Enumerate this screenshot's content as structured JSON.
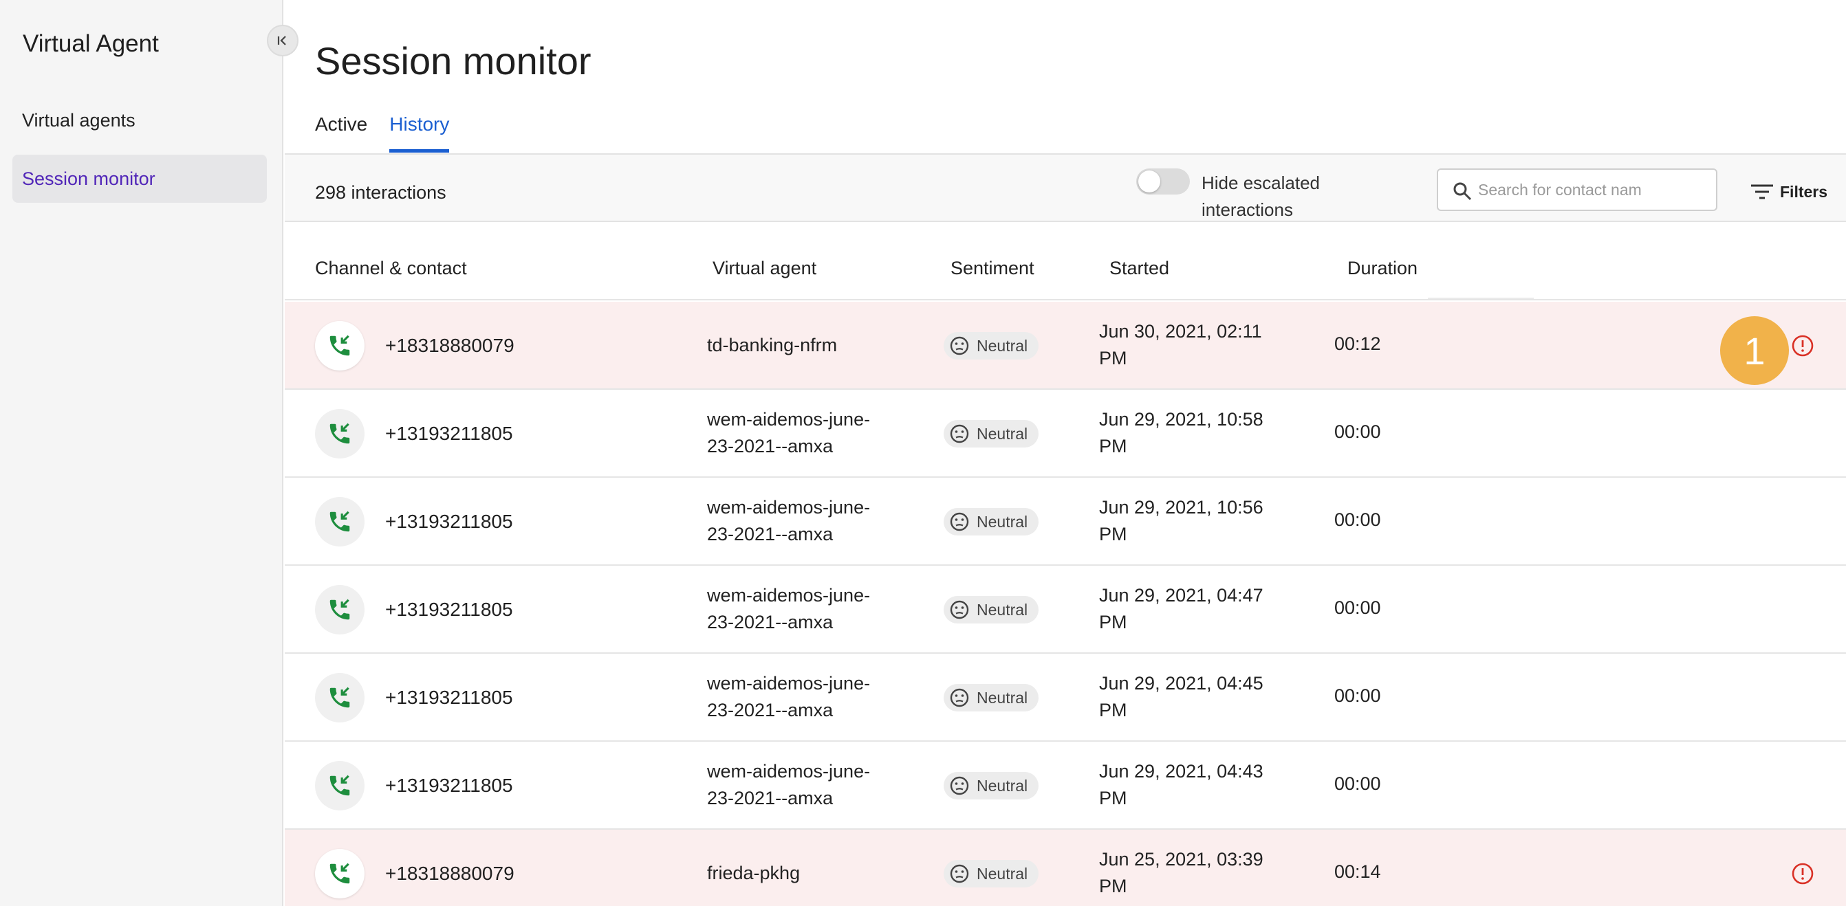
{
  "sidebar": {
    "title": "Virtual Agent",
    "items": [
      {
        "label": "Virtual agents",
        "active": false
      },
      {
        "label": "Session monitor",
        "active": true
      }
    ]
  },
  "header": {
    "title": "Session monitor",
    "tabs": [
      {
        "label": "Active",
        "active": false
      },
      {
        "label": "History",
        "active": true
      }
    ]
  },
  "toolbar": {
    "count": "298 interactions",
    "toggle_label": "Hide escalated interactions",
    "toggle_on": false,
    "search_placeholder": "Search for contact nam",
    "filters_label": "Filters"
  },
  "table": {
    "columns": [
      "Channel & contact",
      "Virtual agent",
      "Sentiment",
      "Started",
      "Duration"
    ],
    "rows": [
      {
        "contact": "+18318880079",
        "agent": "td-banking-nfrm",
        "sentiment": "Neutral",
        "started": "Jun 30, 2021, 02:11 PM",
        "duration": "00:12",
        "escalated": true
      },
      {
        "contact": "+13193211805",
        "agent": "wem-aidemos-june-23-2021--amxa",
        "sentiment": "Neutral",
        "started": "Jun 29, 2021, 10:58 PM",
        "duration": "00:00",
        "escalated": false
      },
      {
        "contact": "+13193211805",
        "agent": "wem-aidemos-june-23-2021--amxa",
        "sentiment": "Neutral",
        "started": "Jun 29, 2021, 10:56 PM",
        "duration": "00:00",
        "escalated": false
      },
      {
        "contact": "+13193211805",
        "agent": "wem-aidemos-june-23-2021--amxa",
        "sentiment": "Neutral",
        "started": "Jun 29, 2021, 04:47 PM",
        "duration": "00:00",
        "escalated": false
      },
      {
        "contact": "+13193211805",
        "agent": "wem-aidemos-june-23-2021--amxa",
        "sentiment": "Neutral",
        "started": "Jun 29, 2021, 04:45 PM",
        "duration": "00:00",
        "escalated": false
      },
      {
        "contact": "+13193211805",
        "agent": "wem-aidemos-june-23-2021--amxa",
        "sentiment": "Neutral",
        "started": "Jun 29, 2021, 04:43 PM",
        "duration": "00:00",
        "escalated": false
      },
      {
        "contact": "+18318880079",
        "agent": "frieda-pkhg",
        "sentiment": "Neutral",
        "started": "Jun 25, 2021, 03:39 PM",
        "duration": "00:14",
        "escalated": true
      }
    ]
  },
  "callout_badge": "1",
  "colors": {
    "accent": "#1b5fd1",
    "sidebar_active_text": "#5126b8",
    "escalated_row": "#fbeeee",
    "alert": "#d93025",
    "badge": "#f1b24a",
    "call_icon": "#1e8e3e"
  },
  "icons": {
    "collapse": "collapse-left-icon",
    "search": "search-icon",
    "filters": "filter-icon",
    "channel": "incoming-call-icon",
    "sentiment": "neutral-face-icon",
    "escalation": "alert-circle-icon"
  }
}
